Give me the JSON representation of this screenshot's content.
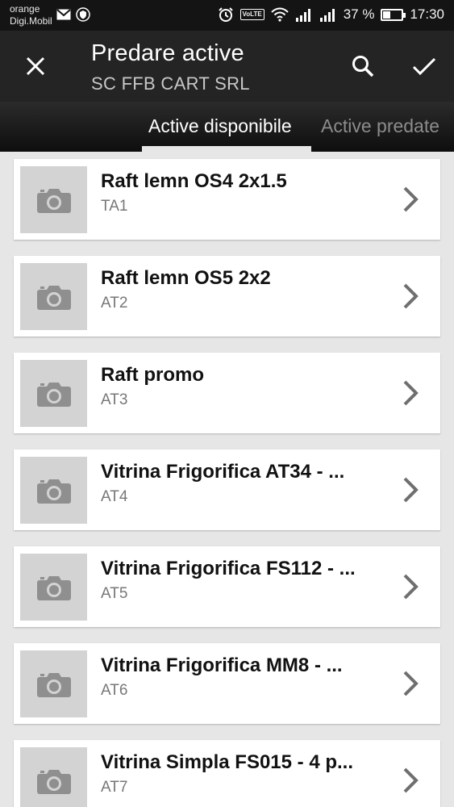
{
  "status_bar": {
    "carrier_line1": "orange",
    "carrier_line2": "Digi.Mobil",
    "volte": "VoLTE",
    "battery_text": "37 %",
    "battery_level": 0.37,
    "time": "17:30"
  },
  "app_bar": {
    "title": "Predare active",
    "subtitle": "SC FFB CART SRL"
  },
  "tabs": [
    {
      "label": "Active disponibile",
      "active": true
    },
    {
      "label": "Active predate",
      "active": false
    }
  ],
  "items": [
    {
      "name": "Raft lemn OS4 2x1.5",
      "code": "TA1"
    },
    {
      "name": "Raft lemn OS5 2x2",
      "code": "AT2"
    },
    {
      "name": "Raft promo",
      "code": "AT3"
    },
    {
      "name": "Vitrina Frigorifica AT34 - ...",
      "code": "AT4"
    },
    {
      "name": "Vitrina Frigorifica FS112 - ...",
      "code": "AT5"
    },
    {
      "name": "Vitrina Frigorifica MM8 - ...",
      "code": "AT6"
    },
    {
      "name": "Vitrina Simpla FS015 - 4 p...",
      "code": "AT7"
    }
  ],
  "icons": {
    "close": "close-icon",
    "search": "search-icon",
    "confirm": "check-icon",
    "thumbnail": "camera-icon",
    "open": "chevron-right-icon"
  },
  "colors": {
    "app_bar": "#242424",
    "background": "#e6e6e6",
    "card": "#ffffff",
    "thumb": "#d3d3d3"
  }
}
